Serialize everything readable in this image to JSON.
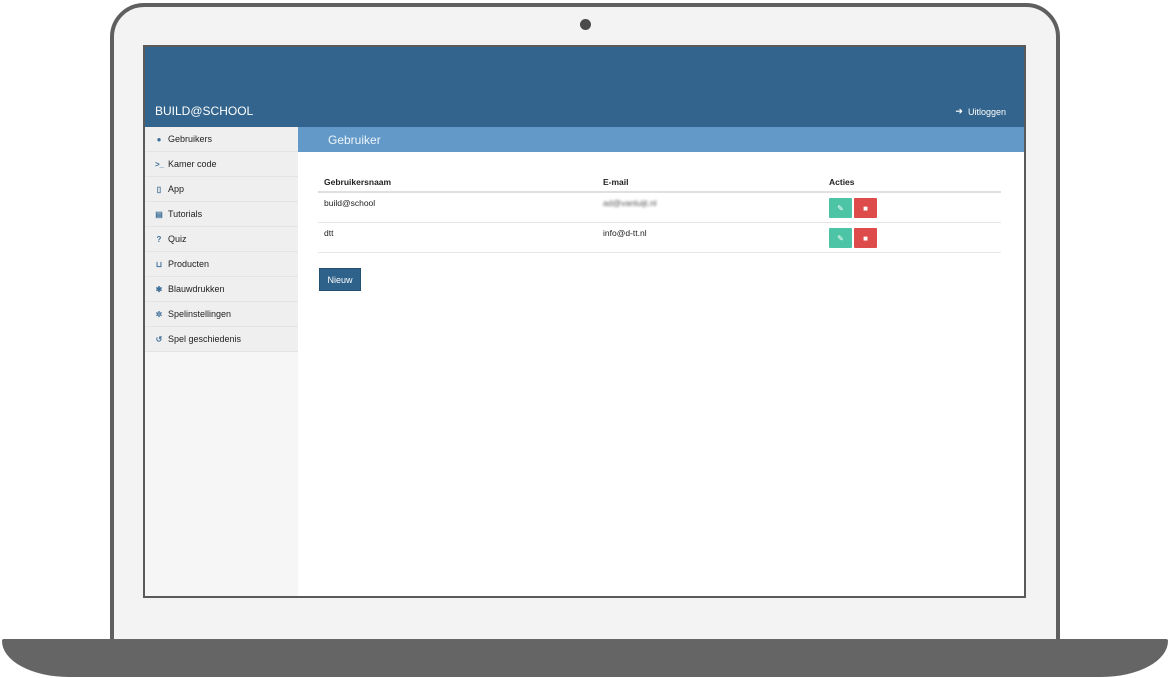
{
  "app": {
    "brand": "BUILD@SCHOOL",
    "logout_label": "Uitloggen"
  },
  "sidebar": {
    "items": [
      {
        "label": "Gebruikers",
        "icon": "user-icon"
      },
      {
        "label": "Kamer code",
        "icon": "terminal-icon"
      },
      {
        "label": "App",
        "icon": "tablet-icon"
      },
      {
        "label": "Tutorials",
        "icon": "book-icon"
      },
      {
        "label": "Quiz",
        "icon": "question-icon"
      },
      {
        "label": "Producten",
        "icon": "cart-icon"
      },
      {
        "label": "Blauwdrukken",
        "icon": "cog-icon"
      },
      {
        "label": "Spelinstellingen",
        "icon": "cogs-icon"
      },
      {
        "label": "Spel geschiedenis",
        "icon": "history-icon"
      }
    ]
  },
  "page": {
    "title": "Gebruiker",
    "table": {
      "columns": [
        "Gebruikersnaam",
        "E-mail",
        "Acties"
      ],
      "rows": [
        {
          "username": "build@school",
          "email": "ad@vanluijt.nl"
        },
        {
          "username": "dtt",
          "email": "info@d-tt.nl"
        }
      ]
    },
    "new_button": "Nieuw"
  },
  "colors": {
    "header": "#32648d",
    "subheader": "#6299c8",
    "edit": "#4cc4a5",
    "delete": "#dd4b4b",
    "primary_button": "#2f628b"
  }
}
